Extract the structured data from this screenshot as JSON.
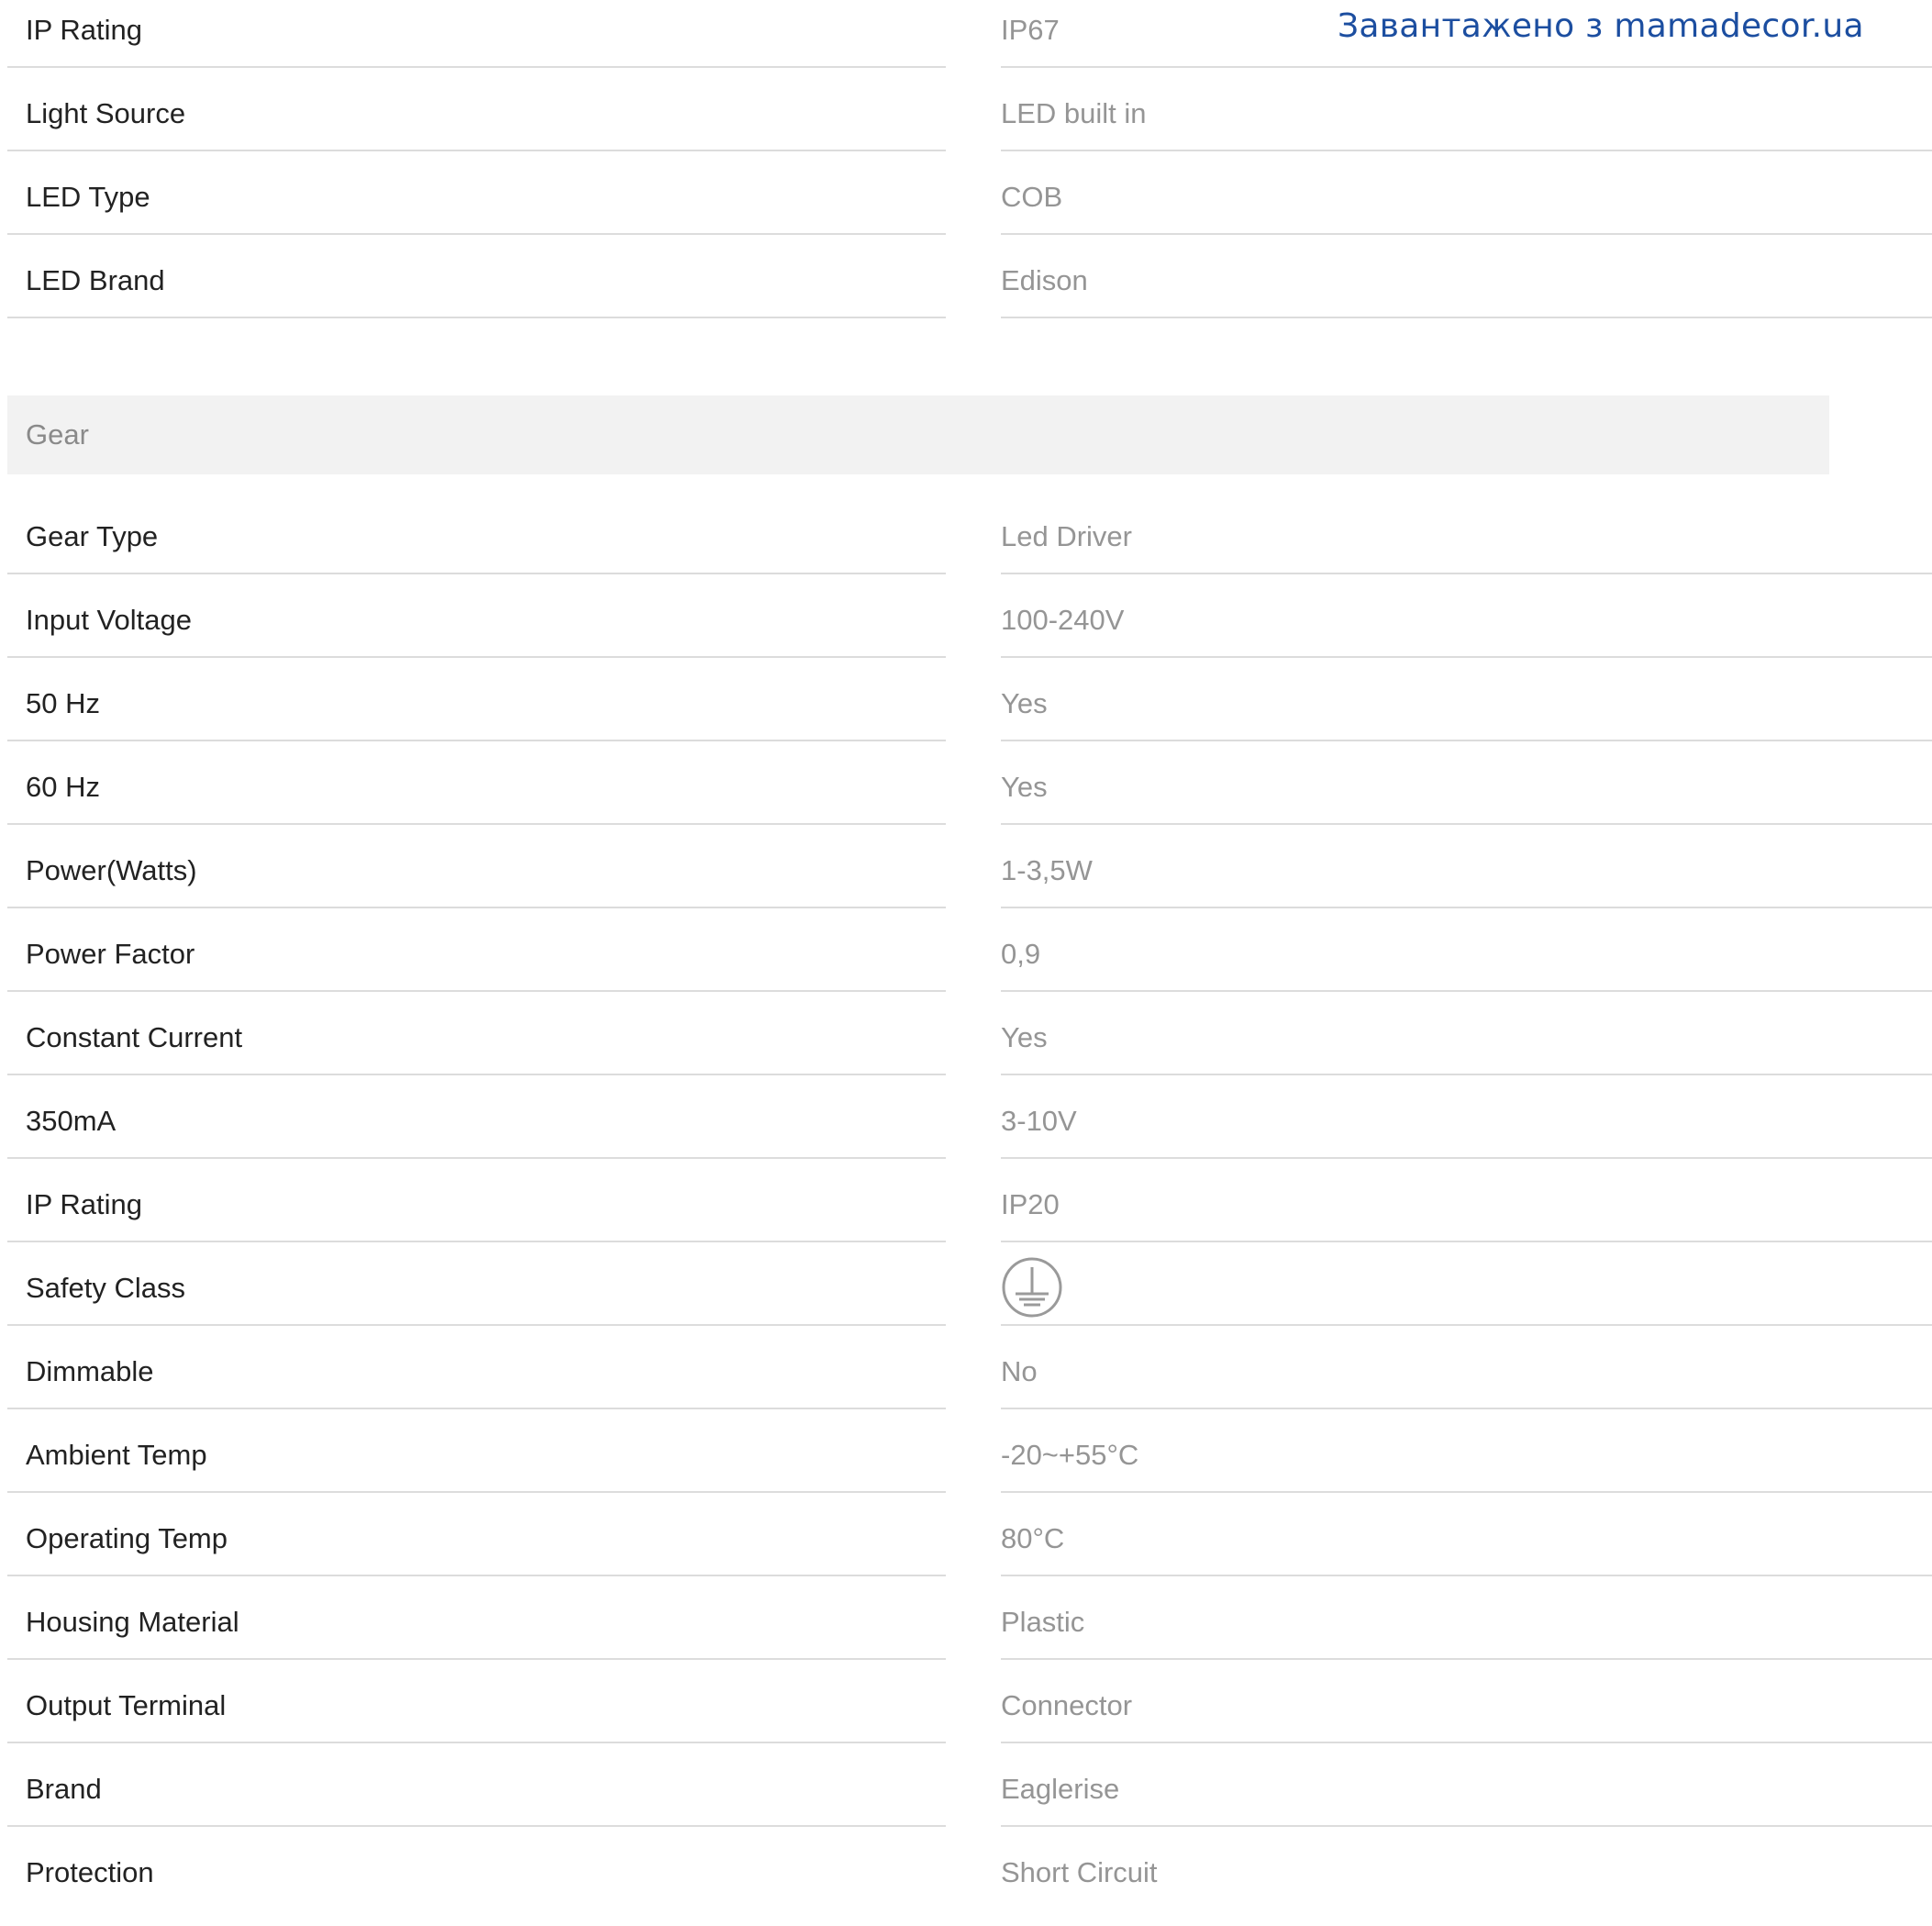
{
  "watermark": "Завантажено з mamadecor.ua",
  "top_rows": [
    {
      "label": "IP Rating",
      "value": "IP67"
    },
    {
      "label": "Light Source",
      "value": "LED built in"
    },
    {
      "label": "LED Type",
      "value": "COB"
    },
    {
      "label": "LED Brand",
      "value": "Edison"
    }
  ],
  "gear_section": {
    "title": "Gear",
    "rows": [
      {
        "label": "Gear Type",
        "value": "Led Driver"
      },
      {
        "label": "Input Voltage",
        "value": "100-240V"
      },
      {
        "label": "50 Hz",
        "value": "Yes"
      },
      {
        "label": "60 Hz",
        "value": "Yes"
      },
      {
        "label": "Power(Watts)",
        "value": "1-3,5W"
      },
      {
        "label": "Power Factor",
        "value": "0,9"
      },
      {
        "label": "Constant Current",
        "value": "Yes"
      },
      {
        "label": "350mA",
        "value": "3-10V"
      },
      {
        "label": "IP Rating",
        "value": "IP20"
      },
      {
        "label": "Safety Class",
        "value": "",
        "icon": "protective-earth-icon"
      },
      {
        "label": "Dimmable",
        "value": "No"
      },
      {
        "label": "Ambient Temp",
        "value": "-20~+55°C"
      },
      {
        "label": "Operating Temp",
        "value": "80°C"
      },
      {
        "label": "Housing Material",
        "value": "Plastic"
      },
      {
        "label": "Output Terminal",
        "value": "Connector"
      },
      {
        "label": "Brand",
        "value": "Eaglerise"
      },
      {
        "label": "Protection",
        "value": "Short Circuit"
      }
    ]
  },
  "colors": {
    "label_text": "#222222",
    "value_text": "#959595",
    "divider": "#dcdcdc",
    "section_bg": "#f2f2f2",
    "watermark": "#1c4ea0"
  }
}
